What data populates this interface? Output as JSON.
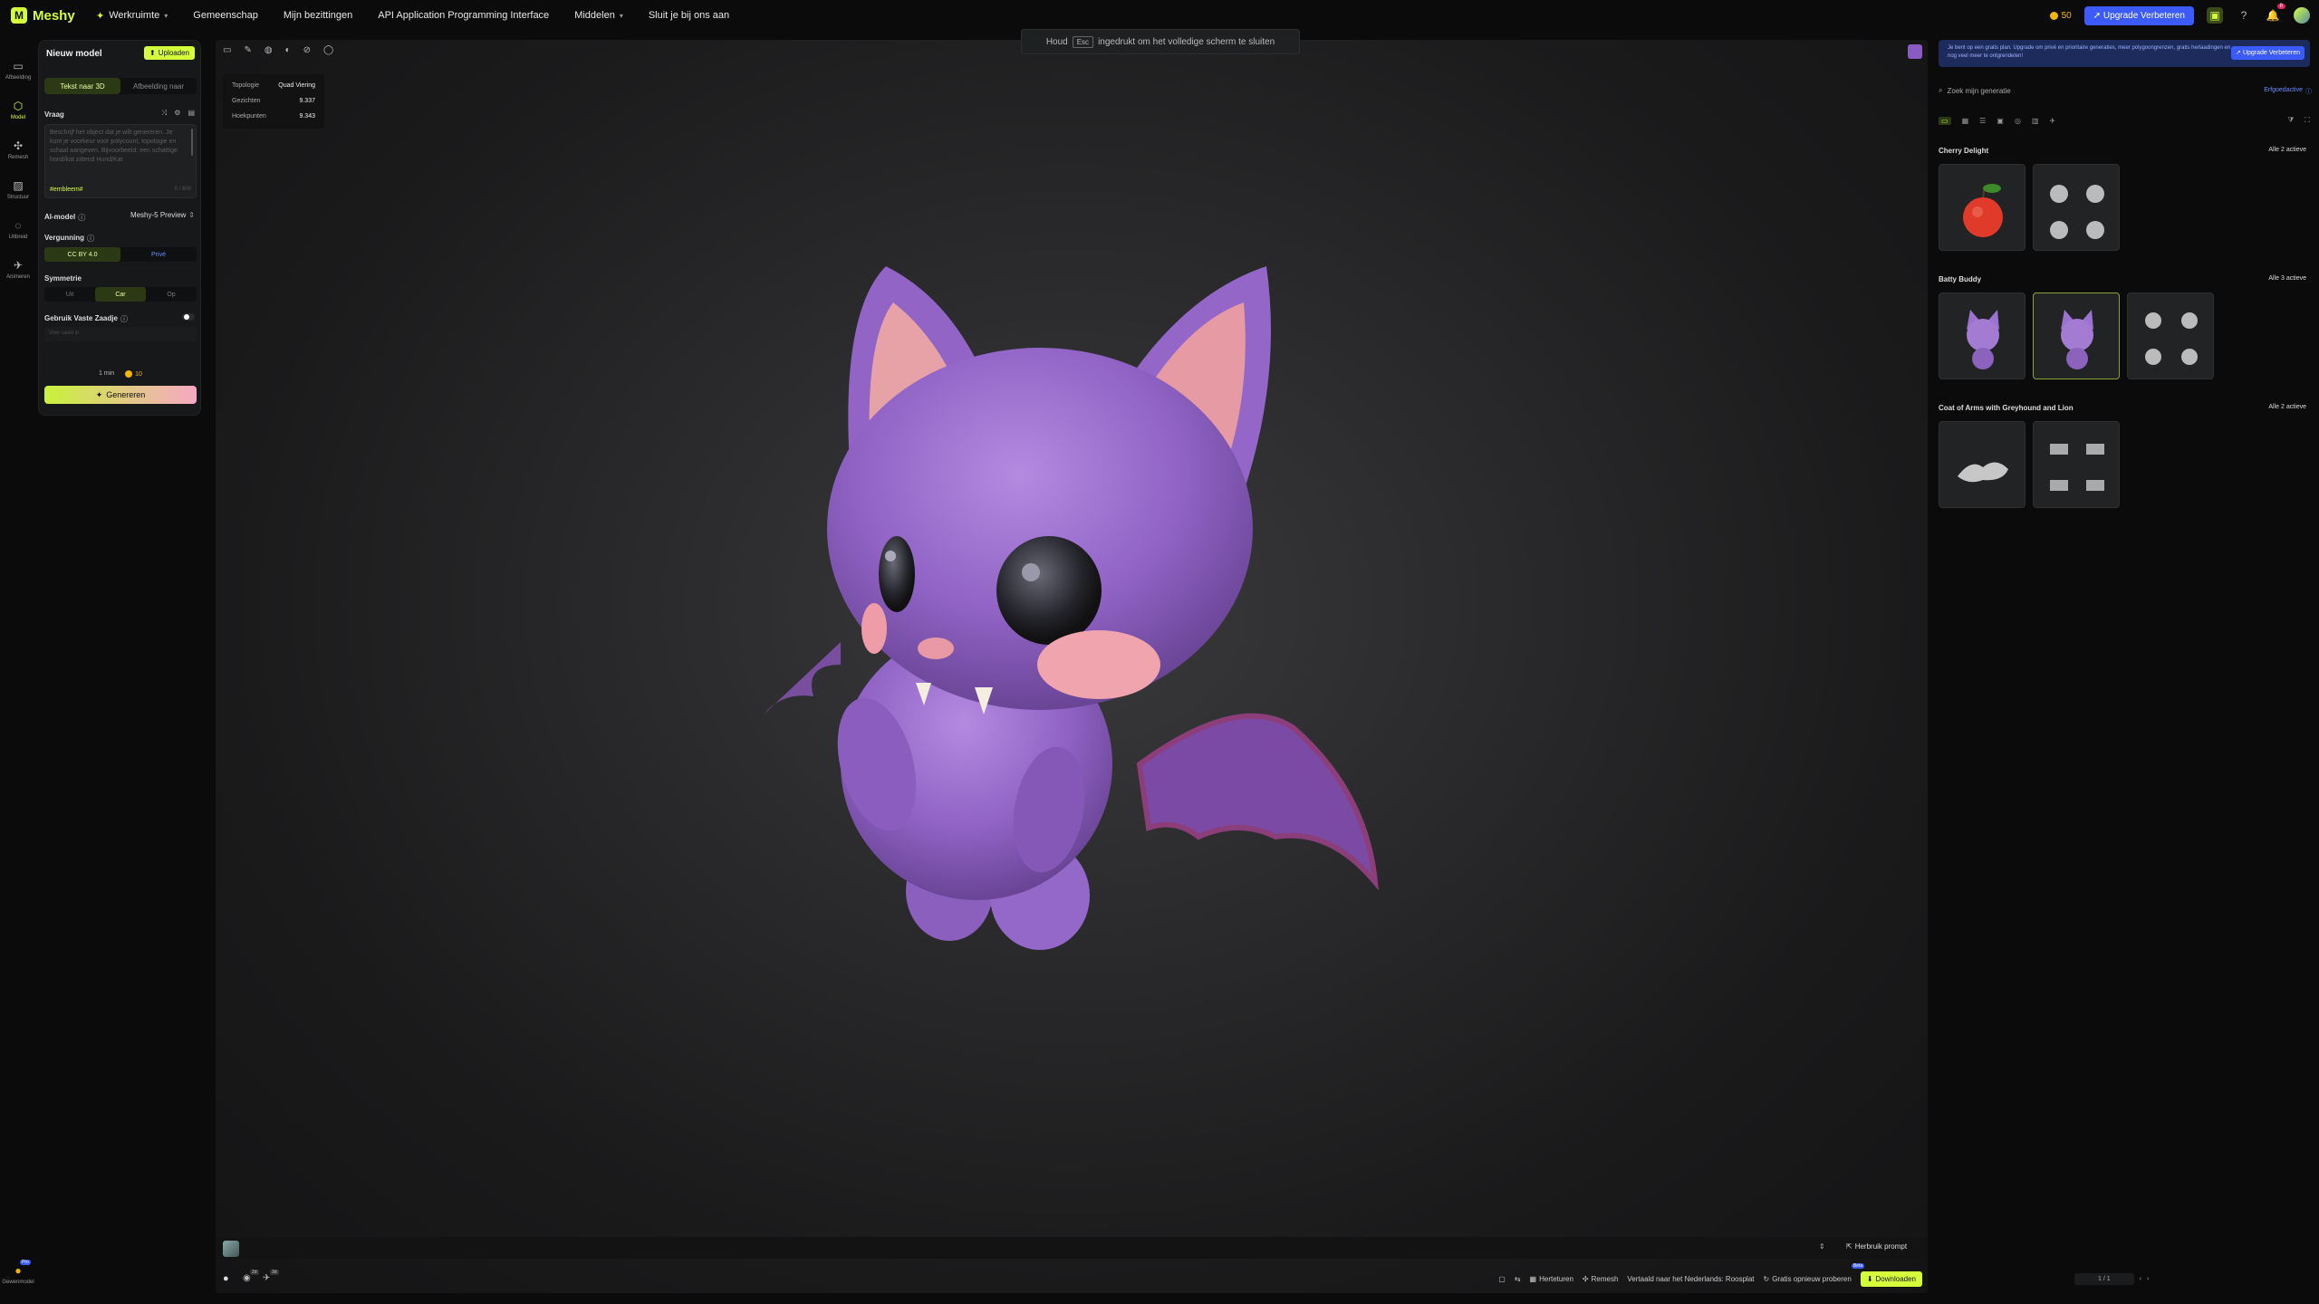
{
  "topbar": {
    "logo": "Meshy",
    "workspace": "Werkruimte",
    "nav": [
      "Gemeenschap",
      "Mijn bezittingen",
      "API Application Programming Interface",
      "Middelen",
      "Sluit je bij ons aan"
    ],
    "credits": "50",
    "upgrade_label": "Upgrade Verbeteren",
    "notif_count": "8"
  },
  "left_rail": {
    "items": [
      {
        "label": "Afbeelding",
        "icon": "image-icon"
      },
      {
        "label": "Model",
        "icon": "cube-icon"
      },
      {
        "label": "Remesh",
        "icon": "remesh-icon"
      },
      {
        "label": "Structuur",
        "icon": "texture-icon"
      },
      {
        "label": "Uitbreid",
        "icon": "expand-icon"
      },
      {
        "label": "Animeren",
        "icon": "animate-icon"
      }
    ],
    "bottom_label": "Gewenmodel",
    "bottom_badge": "Pro"
  },
  "panel": {
    "title": "Nieuw model",
    "upload_label": "Uploaden",
    "tabs": [
      "Tekst naar 3D",
      "Afbeelding naar"
    ],
    "prompt_label": "Vraag",
    "prompt_placeholder": "Beschrijf het object dat je wilt genereren. Je kunt je voorkeur voor polycount, topologie en schaal aangeven. Bijvoorbeeld: een schattige hond/kat zittend Hund/Kat",
    "prompt_tag": "#embleem#",
    "prompt_counter": "0 / 800",
    "ai_model_label": "AI-model",
    "ai_model_value": "Meshy-5 Preview",
    "license_label": "Vergunning",
    "license_options": [
      "CC BY 4.0",
      "Privé"
    ],
    "symmetry_label": "Symmetrie",
    "symmetry_options": [
      "Uit",
      "Car",
      "Op"
    ],
    "seed_label": "Gebruik Vaste Zaadje",
    "seed_placeholder": "Voer seed in",
    "time": "1 min",
    "cost": "10",
    "generate_label": "Genereren"
  },
  "viewport": {
    "esc_hint_pre": "Houd",
    "esc_key": "Esc",
    "esc_hint_post": "ingedrukt om het volledige scherm te sluiten",
    "stats": {
      "topology_label": "Topologie",
      "topology_value": "Quad Viering",
      "faces_label": "Gezichten",
      "faces_value": "9.337",
      "vertices_label": "Hoekpunten",
      "vertices_value": "9.343"
    },
    "reuse_prompt": "Herbruik prompt",
    "bottom_actions": [
      "Herteturen",
      "Remesh",
      "Vertaald naar het Nederlands: Roosplat",
      "Gratis opnieuw proberen"
    ],
    "download_label": "Downloaden",
    "download_badge": "Beta",
    "toggle_badges": [
      "2d",
      "3d"
    ]
  },
  "right_panel": {
    "banner": "Je bent op een gratis plan. Upgrade om privé en prioritaire generaties, meer polygoongrenzen, gratis herlaadingen en nog veel meer te ontgrendelen!",
    "banner_button": "Upgrade Verbeteren",
    "search_placeholder": "Zoek mijn generatie",
    "inherit_label": "Erfgoedactive",
    "groups": [
      {
        "title": "Cherry Delight",
        "active": "Alle 2 actieve"
      },
      {
        "title": "Batty Buddy",
        "active": "Alle 3 actieve"
      },
      {
        "title": "Coat of Arms with Greyhound and Lion",
        "active": "Alle 2 actieve"
      }
    ],
    "pagination": "1 / 1"
  },
  "colors": {
    "accent": "#d4ff3a",
    "brand_blue": "#3b5bff",
    "bat_purple": "#9466c9",
    "ear_pink": "#e7a2a8"
  }
}
